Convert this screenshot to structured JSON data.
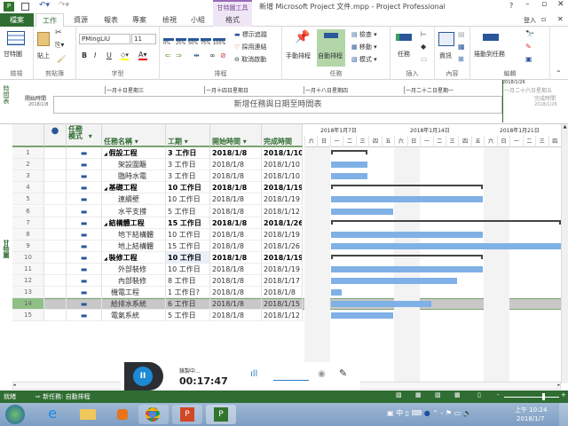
{
  "titlebar": {
    "title": "新增 Microsoft Project 文件.mpp - Project Professional",
    "context_tab": "甘特圖工具",
    "help": "?",
    "signin": "登入"
  },
  "tabs": [
    {
      "label": "檔案"
    },
    {
      "label": "工作"
    },
    {
      "label": "資源"
    },
    {
      "label": "報表"
    },
    {
      "label": "專案"
    },
    {
      "label": "檢視"
    },
    {
      "label": "小組"
    },
    {
      "label": "格式"
    }
  ],
  "ribbon": {
    "view": {
      "button": "甘特圖",
      "group": "檢視"
    },
    "clipboard": {
      "paste": "貼上",
      "group": "剪貼簿"
    },
    "font": {
      "name": "PMingLiU",
      "size": "11",
      "bold": "B",
      "italic": "I",
      "underline": "U",
      "group": "字型"
    },
    "schedule": {
      "percents": [
        "0%",
        "25%",
        "50%",
        "75%",
        "100%"
      ],
      "mark_on_track": "標示追蹤",
      "respect_links": "採用連結",
      "inactivate": "取消啟動",
      "group": "排程"
    },
    "tasks": {
      "manual": "手動排程",
      "auto": "自動排程",
      "inspect": "檢查",
      "move": "移動",
      "mode": "模式",
      "group": "任務"
    },
    "insert": {
      "task": "任務",
      "group": "插入"
    },
    "properties": {
      "info": "資訊",
      "group": "內容"
    },
    "editing": {
      "scroll_to_task": "捲動到任務",
      "group": "編輯"
    }
  },
  "timeline": {
    "side_label": "時間表",
    "start_label": "開始時間",
    "start_date": "2018/1/8",
    "finish_label": "完成時間",
    "finish_date": "2018/1/26",
    "today_marker": "2018/1/26",
    "ticks": [
      "一月十日星期三",
      "一月十四日星期日",
      "一月十八日星期四",
      "一月二十二日星期一",
      "一月二十六日星期五"
    ],
    "placeholder": "新增任務與日期至時間表"
  },
  "gantt": {
    "side_label": "甘特圖",
    "columns": {
      "mode": "任務模式",
      "name": "任務名稱",
      "duration": "工期",
      "start": "開始時間",
      "finish": "完成時間"
    },
    "weeks": [
      "2018年1月7日",
      "2018年1月14日",
      "2018年1月21日"
    ],
    "days": [
      "六",
      "日",
      "一",
      "二",
      "三",
      "四",
      "五",
      "六",
      "日",
      "一",
      "二",
      "三",
      "四",
      "五",
      "六",
      "日",
      "一",
      "二",
      "三",
      "四"
    ],
    "chart_start": "2018/1/6",
    "selected_row": 14,
    "rows": [
      {
        "id": "1",
        "name": "假設工程",
        "duration": "3 工作日",
        "start": "2018/1/8",
        "finish": "2018/1/10",
        "summary": true,
        "indent": 1
      },
      {
        "id": "2",
        "name": "架設圍籬",
        "duration": "3 工作日",
        "start": "2018/1/8",
        "finish": "2018/1/10",
        "summary": false,
        "indent": 2
      },
      {
        "id": "3",
        "name": "臨時水電",
        "duration": "3 工作日",
        "start": "2018/1/8",
        "finish": "2018/1/10",
        "summary": false,
        "indent": 2
      },
      {
        "id": "4",
        "name": "基礎工程",
        "duration": "10 工作日",
        "start": "2018/1/8",
        "finish": "2018/1/19",
        "summary": true,
        "indent": 1
      },
      {
        "id": "5",
        "name": "連續壁",
        "duration": "10 工作日",
        "start": "2018/1/8",
        "finish": "2018/1/19",
        "summary": false,
        "indent": 2
      },
      {
        "id": "6",
        "name": "水平支撐",
        "duration": "5 工作日",
        "start": "2018/1/8",
        "finish": "2018/1/12",
        "summary": false,
        "indent": 2
      },
      {
        "id": "7",
        "name": "結構體工程",
        "duration": "15 工作日",
        "start": "2018/1/8",
        "finish": "2018/1/26",
        "summary": true,
        "indent": 1
      },
      {
        "id": "8",
        "name": "地下結構體",
        "duration": "10 工作日",
        "start": "2018/1/8",
        "finish": "2018/1/19",
        "summary": false,
        "indent": 2
      },
      {
        "id": "9",
        "name": "地上結構體",
        "duration": "15 工作日",
        "start": "2018/1/8",
        "finish": "2018/1/26",
        "summary": false,
        "indent": 2
      },
      {
        "id": "10",
        "name": "裝修工程",
        "duration": "10 工作日",
        "start": "2018/1/8",
        "finish": "2018/1/19",
        "summary": true,
        "indent": 1
      },
      {
        "id": "11",
        "name": "外部裝修",
        "duration": "10 工作日",
        "start": "2018/1/8",
        "finish": "2018/1/19",
        "summary": false,
        "indent": 2
      },
      {
        "id": "12",
        "name": "內部裝修",
        "duration": "8 工作日",
        "start": "2018/1/8",
        "finish": "2018/1/17",
        "summary": false,
        "indent": 2
      },
      {
        "id": "13",
        "name": "機電工程",
        "duration": "1 工作日?",
        "start": "2018/1/8",
        "finish": "2018/1/8",
        "summary": false,
        "indent": 0
      },
      {
        "id": "14",
        "name": "給排水系統",
        "duration": "6 工作日",
        "start": "2018/1/8",
        "finish": "2018/1/15",
        "summary": false,
        "indent": 0
      },
      {
        "id": "15",
        "name": "電氣系統",
        "duration": "5 工作日",
        "start": "2018/1/8",
        "finish": "2018/1/12",
        "summary": false,
        "indent": 0
      }
    ]
  },
  "recorder": {
    "status": "錄製中...",
    "time": "00:17:47"
  },
  "statusbar": {
    "ready": "就緒",
    "new_task": "新任務: 自動排程",
    "zoom_percent": 70
  },
  "taskbar": {
    "time": "上午 10:24",
    "date": "2018/1/7",
    "ime": "中"
  },
  "colors": {
    "accent": "#2f6d32",
    "bar": "#7fb0e6",
    "selected_row": "#c8c8c8"
  }
}
